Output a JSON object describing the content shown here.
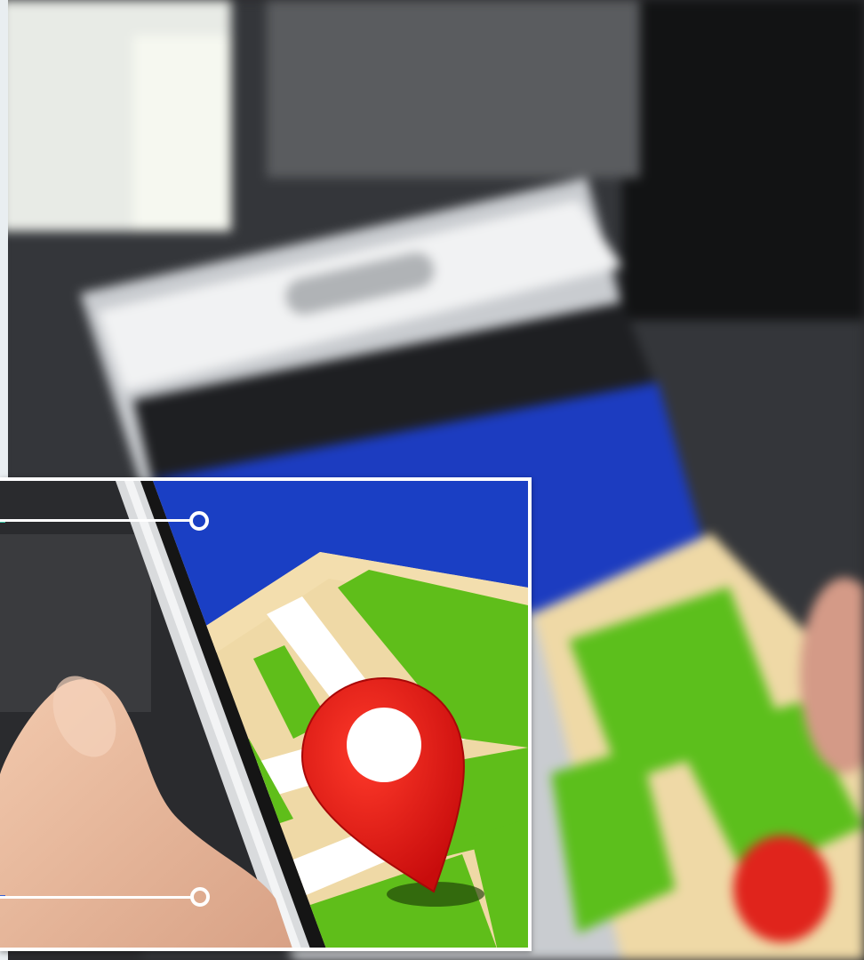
{
  "scene": {
    "description_tags": [
      "smartphone-in-hand",
      "map-application",
      "location-pin"
    ],
    "colors": {
      "map_sky_blue": "#1a3fc4",
      "map_land_tan": "#f2dcaa",
      "map_park_green": "#5fbe1a",
      "map_road_white": "#ffffff",
      "pin_red": "#e01010",
      "phone_silver": "#d8dadc",
      "hand_skin": "#e9b99a",
      "callout_accent_top": "#3cc8a8",
      "callout_accent_bottom": "#3a5fd0"
    },
    "icons": [
      "map-pin-icon"
    ],
    "callouts": [
      {
        "name": "callout-top",
        "accent": "#3cc8a8"
      },
      {
        "name": "callout-bottom",
        "accent": "#3a5fd0"
      }
    ]
  }
}
